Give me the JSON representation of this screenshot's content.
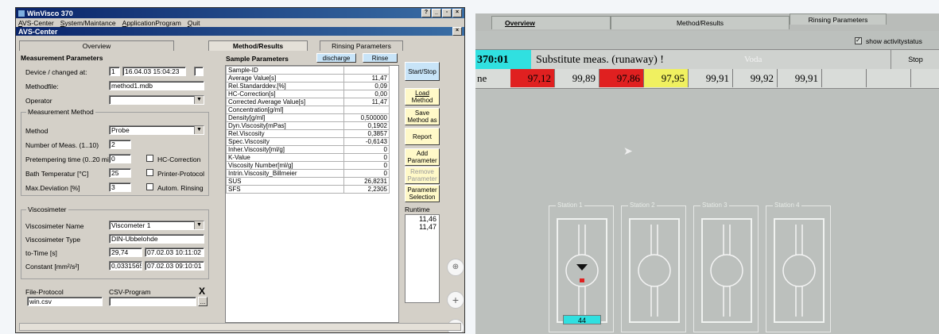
{
  "left": {
    "window_title": "WinVisco 370",
    "menu": [
      "AVS-Center",
      "System/Maintance",
      "ApplicationProgram",
      "Quit"
    ],
    "subwindow_title": "AVS-Center",
    "tabs": [
      "Overview",
      "Method/Results",
      "Rinsing Parameters"
    ],
    "measurement": {
      "title": "Measurement Parameters",
      "device_label": "Device / changed at:",
      "device_value": "1",
      "device_date": "16.04.03 15:04:23",
      "methodfile_label": "Methodfile:",
      "methodfile_value": "method1.mdb",
      "operator_label": "Operator",
      "operator_value": "",
      "method_group": "Measurement Method",
      "method_label": "Method",
      "method_value": "Probe",
      "nmeas_label": "Number of Meas. (1..10)",
      "nmeas_value": "2",
      "pretemp_label": "Pretempering time (0..20 min)",
      "pretemp_value": "0",
      "hc_label": "HC-Correction",
      "bath_label": "Bath Temperatur [°C]",
      "bath_value": "25",
      "printer_label": "Printer-Protocol",
      "maxdev_label": "Max.Deviation [%]",
      "maxdev_value": "3",
      "autom_label": "Autom. Rinsing"
    },
    "viscosimeter": {
      "title": "Viscosimeter",
      "name_label": "Viscosimeter Name",
      "name_value": "Viscometer 1",
      "type_label": "Viscosimeter Type",
      "type_value": "DIN-Ubbelohde",
      "totime_label": "to-Time [s]",
      "totime_value": "29,74",
      "totime_date": "07.02.03 10:11:02",
      "constant_label": "Constant [mm²/s²]",
      "constant_value": "0,0331565",
      "constant_date": "07.02.03 09:10:01"
    },
    "protocol": {
      "file_label": "File-Protocol",
      "file_value": "win.csv",
      "csv_label": "CSV-Program",
      "csv_value": "",
      "close_label": "X",
      "browse_label": "..."
    },
    "sample": {
      "title": "Sample Parameters",
      "discharge_label": "discharge",
      "rinse_label": "Rinse",
      "rows": [
        {
          "name": "Sample-ID",
          "value": ""
        },
        {
          "name": "Average Value[s]",
          "value": "11,47"
        },
        {
          "name": "Rel.Standarddev.[%]",
          "value": "0,09"
        },
        {
          "name": "HC-Correction[s]",
          "value": "0,00"
        },
        {
          "name": "Corrected Average Value[s]",
          "value": "11,47"
        },
        {
          "name": "Concentration[g/ml]",
          "value": ""
        },
        {
          "name": "Density[g/ml]",
          "value": "0,500000"
        },
        {
          "name": "Dyn.Viscosity[mPas]",
          "value": "0,1902"
        },
        {
          "name": "Rel.Viscosity",
          "value": "0,3857"
        },
        {
          "name": "Spec.Viscosity",
          "value": "-0,6143"
        },
        {
          "name": "Inher.Viscosity[ml/g]",
          "value": "0"
        },
        {
          "name": "K-Value",
          "value": "0"
        },
        {
          "name": "Viscosity Number[ml/g]",
          "value": "0"
        },
        {
          "name": "Intrin.Viscosity_Billmeier",
          "value": "0"
        },
        {
          "name": "SUS",
          "value": "26,8231"
        },
        {
          "name": "SFS",
          "value": "2,2305"
        }
      ]
    },
    "buttons": {
      "startstop": "Start/Stop",
      "load": [
        "Load",
        "Method"
      ],
      "save": [
        "Save",
        "Method as"
      ],
      "report": "Report",
      "add": [
        "Add",
        "Parameter"
      ],
      "remove": [
        "Remove",
        "Parameter"
      ],
      "selection": [
        "Parameter",
        "Selection"
      ]
    },
    "runtime": {
      "label": "Runtime",
      "values": [
        "11,46",
        "11,47"
      ]
    }
  },
  "right": {
    "tabs": [
      "Overview",
      "Method/Results",
      "Rinsing Parameters"
    ],
    "show_activity_label": "show activitystatus",
    "status_id": "370:01",
    "status_text": "Substitute meas. (runaway) !",
    "status_extra": "Voda",
    "stop_label": "Stop",
    "row_label": "ne",
    "values": [
      {
        "v": "97,12",
        "color": "#e02020"
      },
      {
        "v": "99,89",
        "color": ""
      },
      {
        "v": "97,86",
        "color": "#e02020"
      },
      {
        "v": "97,95",
        "color": "#f0f060"
      },
      {
        "v": "99,91",
        "color": ""
      },
      {
        "v": "99,92",
        "color": ""
      },
      {
        "v": "99,91",
        "color": ""
      }
    ],
    "stations": [
      "Station 1",
      "Station 2",
      "Station 3",
      "Station 4"
    ],
    "station1_level": "44",
    "accent_cyan": "#30e0e0"
  }
}
